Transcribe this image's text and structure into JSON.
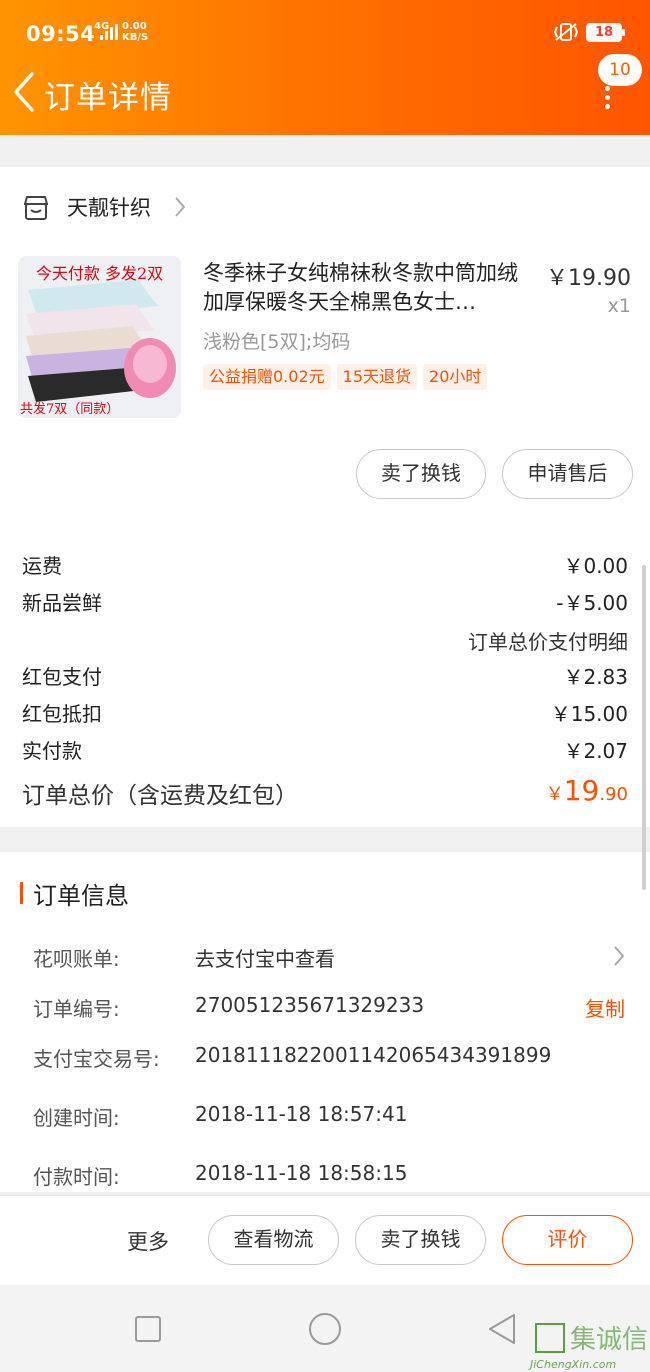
{
  "status_bar": {
    "time": "09:54",
    "network": "4G",
    "speed_value": "0.00",
    "speed_unit": "KB/S",
    "battery": "18"
  },
  "header": {
    "title": "订单详情",
    "badge_count": "10"
  },
  "shop": {
    "name": "天靓针织"
  },
  "product": {
    "thumb_top_text": "今天付款  多发2双",
    "thumb_bottom_text": "共发7双（同款）",
    "title": "冬季袜子女纯棉袜秋冬款中筒加绒加厚保暖冬天全棉黑色女士…",
    "price": "￥19.90",
    "quantity": "x1",
    "spec": "浅粉色[5双];均码",
    "tags": [
      "公益捐赠0.02元",
      "15天退货",
      "20小时"
    ]
  },
  "item_actions": {
    "sell": "卖了换钱",
    "after_sale": "申请售后"
  },
  "fees": {
    "shipping_label": "运费",
    "shipping_value": "￥0.00",
    "newbie_label": "新品尝鲜",
    "newbie_value": "-￥5.00",
    "detail_link": "订单总价支付明细",
    "redpack_pay_label": "红包支付",
    "redpack_pay_value": "￥2.83",
    "redpack_deduct_label": "红包抵扣",
    "redpack_deduct_value": "￥15.00",
    "paid_label": "实付款",
    "paid_value": "￥2.07",
    "total_label": "订单总价（含运费及红包）",
    "total_currency": "￥",
    "total_int": "19",
    "total_dec": ".90"
  },
  "order_info": {
    "section_title": "订单信息",
    "huabei_label": "花呗账单:",
    "huabei_value": "去支付宝中查看",
    "order_no_label": "订单编号:",
    "order_no_value": "2700512356713292​33",
    "copy_label": "复制",
    "alipay_label": "支付宝交易号:",
    "alipay_value": "2018111822001142065434391899",
    "created_label": "创建时间:",
    "created_value": "2018-11-18 18:57:41",
    "paid_time_label": "付款时间:",
    "paid_time_value": "2018-11-18 18:58:15"
  },
  "bottom_bar": {
    "more": "更多",
    "logistics": "查看物流",
    "sell": "卖了换钱",
    "rate": "评价"
  },
  "watermark": {
    "brand": "集诚信",
    "url": "JiChengXin.com"
  },
  "colors": {
    "accent": "#ff5000",
    "header_start": "#ff9400",
    "header_end": "#ff5500"
  }
}
